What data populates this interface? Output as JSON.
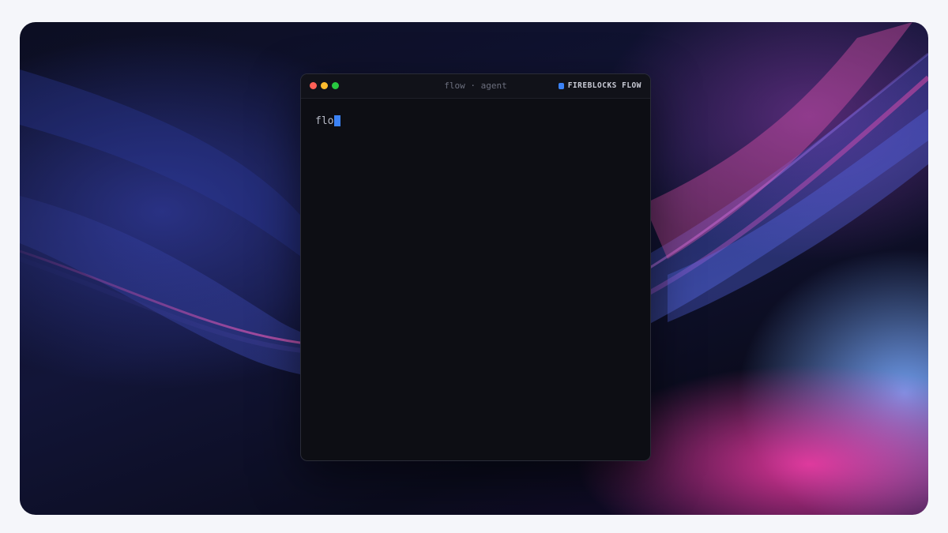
{
  "window": {
    "title": "flow · agent",
    "brand_label": "FIREBLOCKS FLOW",
    "brand_icon": "square-logo-icon",
    "controls": [
      "close",
      "minimize",
      "maximize"
    ]
  },
  "terminal": {
    "input_text": "flo",
    "cursor_color": "#3b82f6"
  },
  "colors": {
    "close": "#ff5f57",
    "minimize": "#febc2e",
    "maximize": "#28c840",
    "accent": "#3b82f6"
  }
}
